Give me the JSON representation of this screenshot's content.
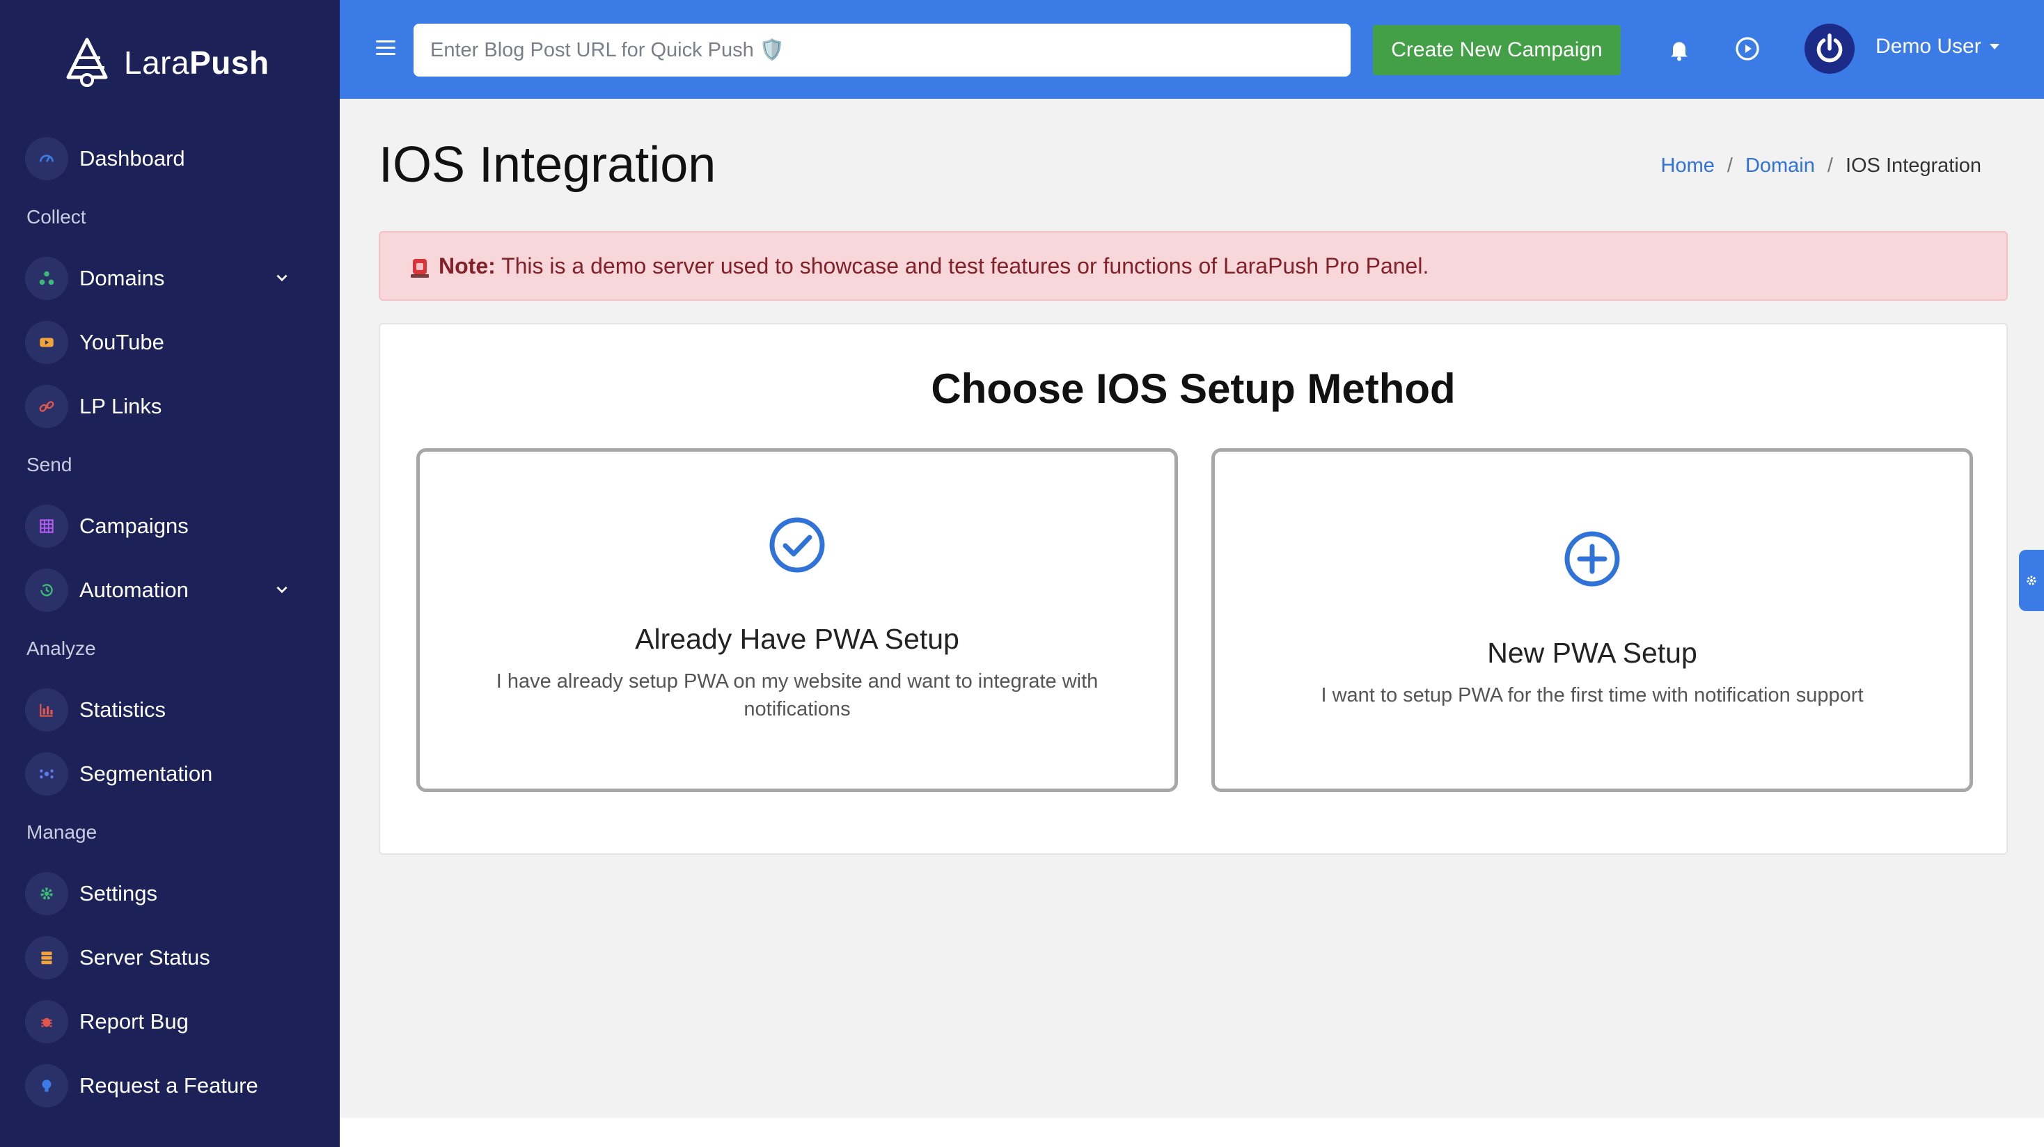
{
  "brand": {
    "name_light": "Lara",
    "name_bold": "Push"
  },
  "sidebar": {
    "items": [
      {
        "label": "Dashboard",
        "icon": "speedometer-icon",
        "color": "#3a7be5"
      },
      {
        "label": "Domains",
        "icon": "sitemap-icon",
        "color": "#3cb878",
        "expandable": true
      },
      {
        "label": "YouTube",
        "icon": "youtube-icon",
        "color": "#f2a43a"
      },
      {
        "label": "LP Links",
        "icon": "link-icon",
        "color": "#e2574c"
      },
      {
        "label": "Campaigns",
        "icon": "grid-icon",
        "color": "#b45cf0"
      },
      {
        "label": "Automation",
        "icon": "history-icon",
        "color": "#3cb878",
        "expandable": true
      },
      {
        "label": "Statistics",
        "icon": "bar-chart-icon",
        "color": "#e2574c"
      },
      {
        "label": "Segmentation",
        "icon": "segment-icon",
        "color": "#5b7cf0"
      },
      {
        "label": "Settings",
        "icon": "gear-icon",
        "color": "#3cb878"
      },
      {
        "label": "Server Status",
        "icon": "server-icon",
        "color": "#f2a43a"
      },
      {
        "label": "Report Bug",
        "icon": "bug-icon",
        "color": "#e2574c"
      },
      {
        "label": "Request a Feature",
        "icon": "lightbulb-icon",
        "color": "#3a7be5"
      }
    ],
    "sections": {
      "collect": "Collect",
      "send": "Send",
      "analyze": "Analyze",
      "manage": "Manage"
    }
  },
  "header": {
    "quick_push_placeholder": "Enter Blog Post URL for Quick Push 🛡️",
    "create_button": "Create New Campaign",
    "user_name": "Demo User",
    "accent": "#3a7be5",
    "button_color": "#43a047"
  },
  "page": {
    "title": "IOS Integration",
    "breadcrumb": {
      "home": "Home",
      "domain": "Domain",
      "current": "IOS Integration"
    }
  },
  "alert": {
    "label": "Note:",
    "text": " This is a demo server used to showcase and test features or functions of LaraPush Pro Panel."
  },
  "setup": {
    "title": "Choose IOS Setup Method",
    "options": [
      {
        "title": "Already Have PWA Setup",
        "description": "I have already setup PWA on my website and want to integrate with notifications",
        "icon": "check-circle-icon"
      },
      {
        "title": "New PWA Setup",
        "description": "I want to setup PWA for the first time with notification support",
        "icon": "plus-circle-icon"
      }
    ]
  }
}
